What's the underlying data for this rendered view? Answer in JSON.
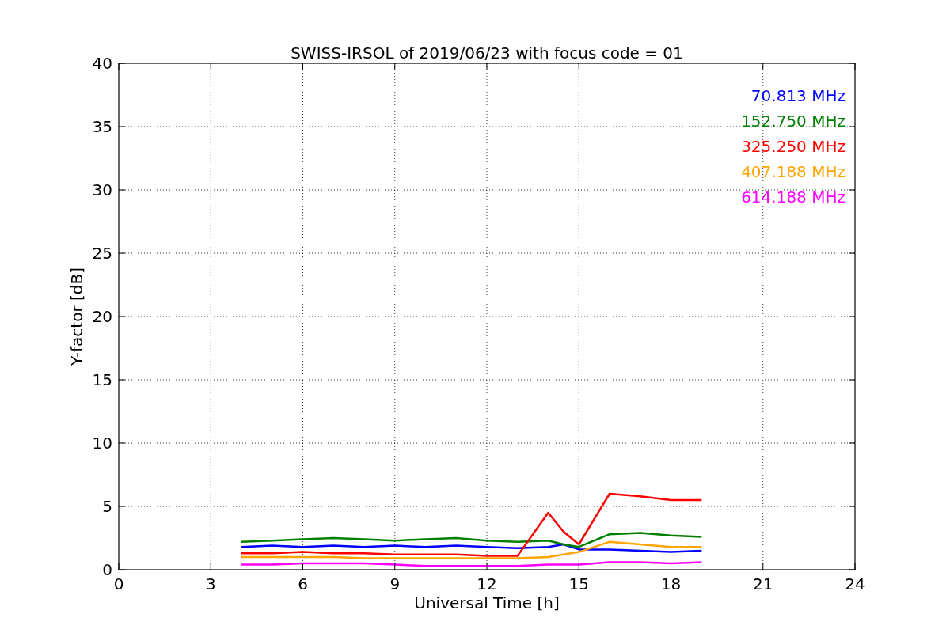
{
  "chart_data": {
    "type": "line",
    "title": "SWISS-IRSOL of 2019/06/23 with focus code = 01",
    "xlabel": "Universal Time [h]",
    "ylabel": "Y-factor [dB]",
    "x": [
      4,
      5,
      6,
      7,
      8,
      9,
      10,
      11,
      12,
      13,
      14,
      14.5,
      15,
      16,
      17,
      18,
      19
    ],
    "series": [
      {
        "name": "70.813 MHz",
        "color": "#0000ff",
        "values": [
          1.8,
          1.9,
          1.8,
          1.9,
          1.8,
          1.9,
          1.8,
          1.9,
          1.8,
          1.7,
          1.8,
          2.0,
          1.6,
          1.6,
          1.5,
          1.4,
          1.5
        ]
      },
      {
        "name": "152.750 MHz",
        "color": "#008000",
        "values": [
          2.2,
          2.3,
          2.4,
          2.5,
          2.4,
          2.3,
          2.4,
          2.5,
          2.3,
          2.2,
          2.3,
          2.0,
          1.8,
          2.8,
          2.9,
          2.7,
          2.6
        ]
      },
      {
        "name": "325.250 MHz",
        "color": "#ff0000",
        "values": [
          1.3,
          1.3,
          1.4,
          1.3,
          1.3,
          1.2,
          1.2,
          1.2,
          1.1,
          1.1,
          4.5,
          3.0,
          2.0,
          6.0,
          5.8,
          5.5,
          5.5
        ]
      },
      {
        "name": "407.188 MHz",
        "color": "#ffa500",
        "values": [
          1.0,
          1.0,
          1.0,
          1.0,
          0.9,
          0.9,
          0.9,
          0.9,
          0.9,
          0.9,
          1.0,
          1.2,
          1.4,
          2.2,
          2.0,
          1.8,
          1.8
        ]
      },
      {
        "name": "614.188 MHz",
        "color": "#ff00ff",
        "values": [
          0.4,
          0.4,
          0.5,
          0.5,
          0.5,
          0.4,
          0.3,
          0.3,
          0.3,
          0.3,
          0.4,
          0.4,
          0.4,
          0.6,
          0.6,
          0.5,
          0.6
        ]
      }
    ],
    "xlim": [
      0,
      24
    ],
    "ylim": [
      0,
      40
    ],
    "xticks": [
      0,
      3,
      6,
      9,
      12,
      15,
      18,
      21,
      24
    ],
    "yticks": [
      0,
      5,
      10,
      15,
      20,
      25,
      30,
      35,
      40
    ],
    "grid": true
  }
}
